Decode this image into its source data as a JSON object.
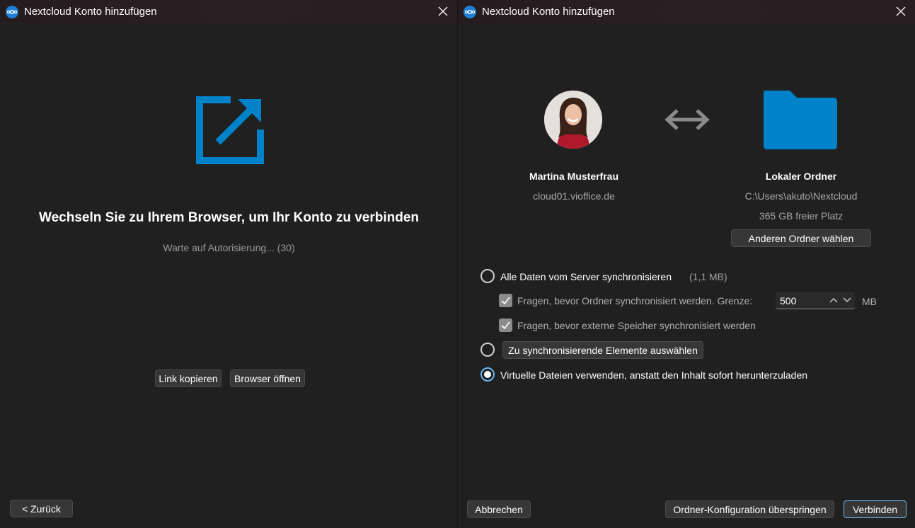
{
  "left_window": {
    "title": "Nextcloud Konto hinzufügen",
    "heading": "Wechseln Sie zu Ihrem Browser, um Ihr Konto zu verbinden",
    "status": "Warte auf Autorisierung... (30)",
    "buttons": {
      "copy_link": "Link kopieren",
      "open_browser": "Browser öffnen",
      "back": "< Zurück"
    },
    "icon": "external-link-icon"
  },
  "right_window": {
    "title": "Nextcloud Konto hinzufügen",
    "account": {
      "name": "Martina Musterfrau",
      "server": "cloud01.vioffice.de"
    },
    "local": {
      "title": "Lokaler Ordner",
      "path": "C:\\Users\\akuto\\Nextcloud",
      "free_space": "365 GB freier Platz",
      "choose_button": "Anderen Ordner wählen"
    },
    "options": {
      "sync_all": {
        "label": "Alle Daten vom Server synchronisieren",
        "note": "(1,1 MB)",
        "selected": false
      },
      "ask_folders": {
        "label": "Fragen, bevor Ordner synchronisiert werden. Grenze:",
        "checked": true,
        "limit": "500",
        "unit": "MB"
      },
      "ask_external": {
        "label": "Fragen, bevor externe Speicher synchronisiert werden",
        "checked": true
      },
      "choose_items": {
        "label": "Zu synchronisierende Elemente auswählen",
        "selected": false
      },
      "virtual_files": {
        "label": "Virtuelle Dateien verwenden, anstatt den Inhalt sofort herunterzuladen",
        "selected": true
      }
    },
    "buttons": {
      "cancel": "Abbrechen",
      "skip": "Ordner-Konfiguration überspringen",
      "connect": "Verbinden"
    }
  },
  "colors": {
    "accent": "#0082c9",
    "background": "#202020",
    "button": "#373737",
    "focus": "#6fb8ec"
  }
}
